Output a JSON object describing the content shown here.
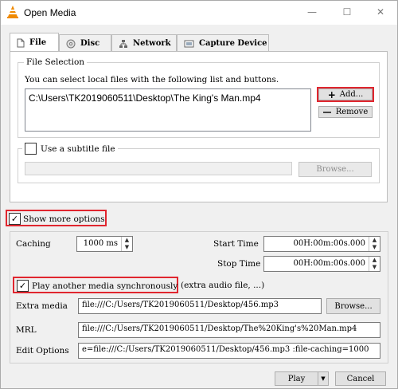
{
  "window": {
    "title": "Open Media",
    "minimize": "—",
    "maximize": "☐",
    "close": "✕"
  },
  "tabs": [
    {
      "label": "File",
      "icon": "file-icon"
    },
    {
      "label": "Disc",
      "icon": "disc-icon"
    },
    {
      "label": "Network",
      "icon": "network-icon"
    },
    {
      "label": "Capture Device",
      "icon": "capture-device-icon"
    }
  ],
  "file_selection": {
    "group_label": "File Selection",
    "description": "You can select local files with the following list and buttons.",
    "files": [
      "C:\\Users\\TK2019060511\\Desktop\\The King's Man.mp4"
    ],
    "add_label": "Add...",
    "remove_label": "Remove"
  },
  "subtitle": {
    "checkbox_label": "Use a subtitle file",
    "checked": false,
    "path_value": "",
    "browse_label": "Browse..."
  },
  "show_more": {
    "label": "Show more options",
    "checked": true
  },
  "options": {
    "caching_label": "Caching",
    "caching_value": "1000 ms",
    "start_time_label": "Start Time",
    "start_time_value": "00H:00m:00s.000",
    "stop_time_label": "Stop Time",
    "stop_time_value": "00H:00m:00s.000",
    "sync_label": "Play another media synchronously",
    "sync_checked": true,
    "sync_hint": "(extra audio file, ...)",
    "extra_media_label": "Extra media",
    "extra_media_value": "file:///C:/Users/TK2019060511/Desktop/456.mp3",
    "extra_browse_label": "Browse...",
    "mrl_label": "MRL",
    "mrl_value": "file:///C:/Users/TK2019060511/Desktop/The%20King's%20Man.mp4",
    "edit_options_label": "Edit Options",
    "edit_options_value": "e=file:///C:/Users/TK2019060511/Desktop/456.mp3 :file-caching=1000"
  },
  "footer": {
    "play_label": "Play",
    "cancel_label": "Cancel"
  },
  "colors": {
    "highlight_red": "#e0262f",
    "vlc_orange": "#f08a00"
  }
}
